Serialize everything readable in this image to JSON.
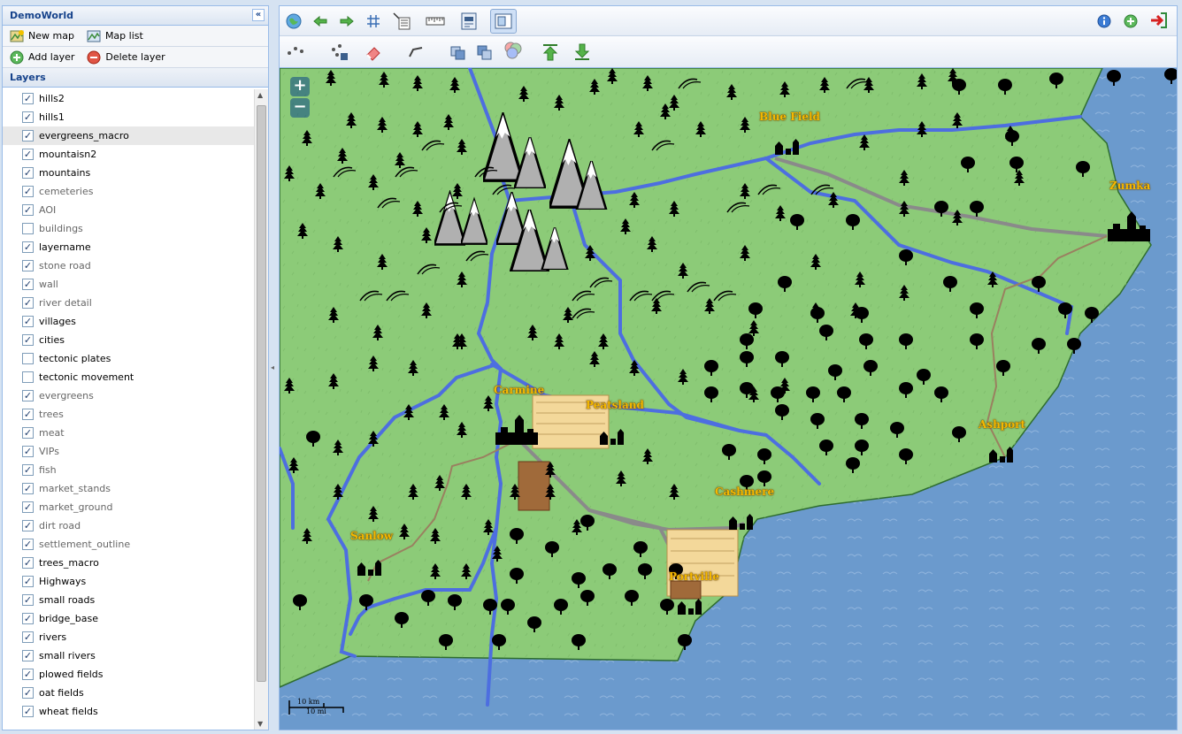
{
  "app": {
    "title": "DemoWorld"
  },
  "sidebar": {
    "new_map": "New map",
    "map_list": "Map list",
    "add_layer": "Add layer",
    "delete_layer": "Delete layer",
    "layers_title": "Layers",
    "collapse": "«"
  },
  "layers": [
    {
      "name": "hills2",
      "checked": true
    },
    {
      "name": "hills1",
      "checked": true
    },
    {
      "name": "evergreens_macro",
      "checked": true,
      "selected": true
    },
    {
      "name": "mountaisn2",
      "checked": true
    },
    {
      "name": "mountains",
      "checked": true
    },
    {
      "name": "cemeteries",
      "checked": true,
      "dim": true
    },
    {
      "name": "AOI",
      "checked": true,
      "dim": true
    },
    {
      "name": "buildings",
      "checked": false,
      "dim": true
    },
    {
      "name": "layername",
      "checked": true
    },
    {
      "name": "stone road",
      "checked": true,
      "dim": true
    },
    {
      "name": "wall",
      "checked": true,
      "dim": true
    },
    {
      "name": "river detail",
      "checked": true,
      "dim": true
    },
    {
      "name": "villages",
      "checked": true
    },
    {
      "name": "cities",
      "checked": true
    },
    {
      "name": "tectonic plates",
      "checked": false
    },
    {
      "name": "tectonic movement",
      "checked": false
    },
    {
      "name": "evergreens",
      "checked": true,
      "dim": true
    },
    {
      "name": "trees",
      "checked": true,
      "dim": true
    },
    {
      "name": "meat",
      "checked": true,
      "dim": true
    },
    {
      "name": "VIPs",
      "checked": true,
      "dim": true
    },
    {
      "name": "fish",
      "checked": true,
      "dim": true
    },
    {
      "name": "market_stands",
      "checked": true,
      "dim": true
    },
    {
      "name": "market_ground",
      "checked": true,
      "dim": true
    },
    {
      "name": "dirt road",
      "checked": true,
      "dim": true
    },
    {
      "name": "settlement_outline",
      "checked": true,
      "dim": true
    },
    {
      "name": "trees_macro",
      "checked": true
    },
    {
      "name": "Highways",
      "checked": true
    },
    {
      "name": "small roads",
      "checked": true
    },
    {
      "name": "bridge_base",
      "checked": true
    },
    {
      "name": "rivers",
      "checked": true
    },
    {
      "name": "small rivers",
      "checked": true
    },
    {
      "name": "plowed fields",
      "checked": true
    },
    {
      "name": "oat fields",
      "checked": true
    },
    {
      "name": "wheat fields",
      "checked": true
    }
  ],
  "map": {
    "zoom_in": "+",
    "zoom_out": "−",
    "scale_km": "10 km",
    "scale_mi": "10 mi",
    "places": [
      {
        "name": "Blue Field"
      },
      {
        "name": "Zumka"
      },
      {
        "name": "Carmine"
      },
      {
        "name": "Peatsland"
      },
      {
        "name": "Ashport"
      },
      {
        "name": "Cashmere"
      },
      {
        "name": "Sanlow"
      },
      {
        "name": "Portville"
      }
    ]
  },
  "colors": {
    "land": "#8ccb78",
    "sea": "#6b9acd",
    "river": "#4d6ee0",
    "road": "#8a8a8a",
    "label": "#f5b800"
  }
}
